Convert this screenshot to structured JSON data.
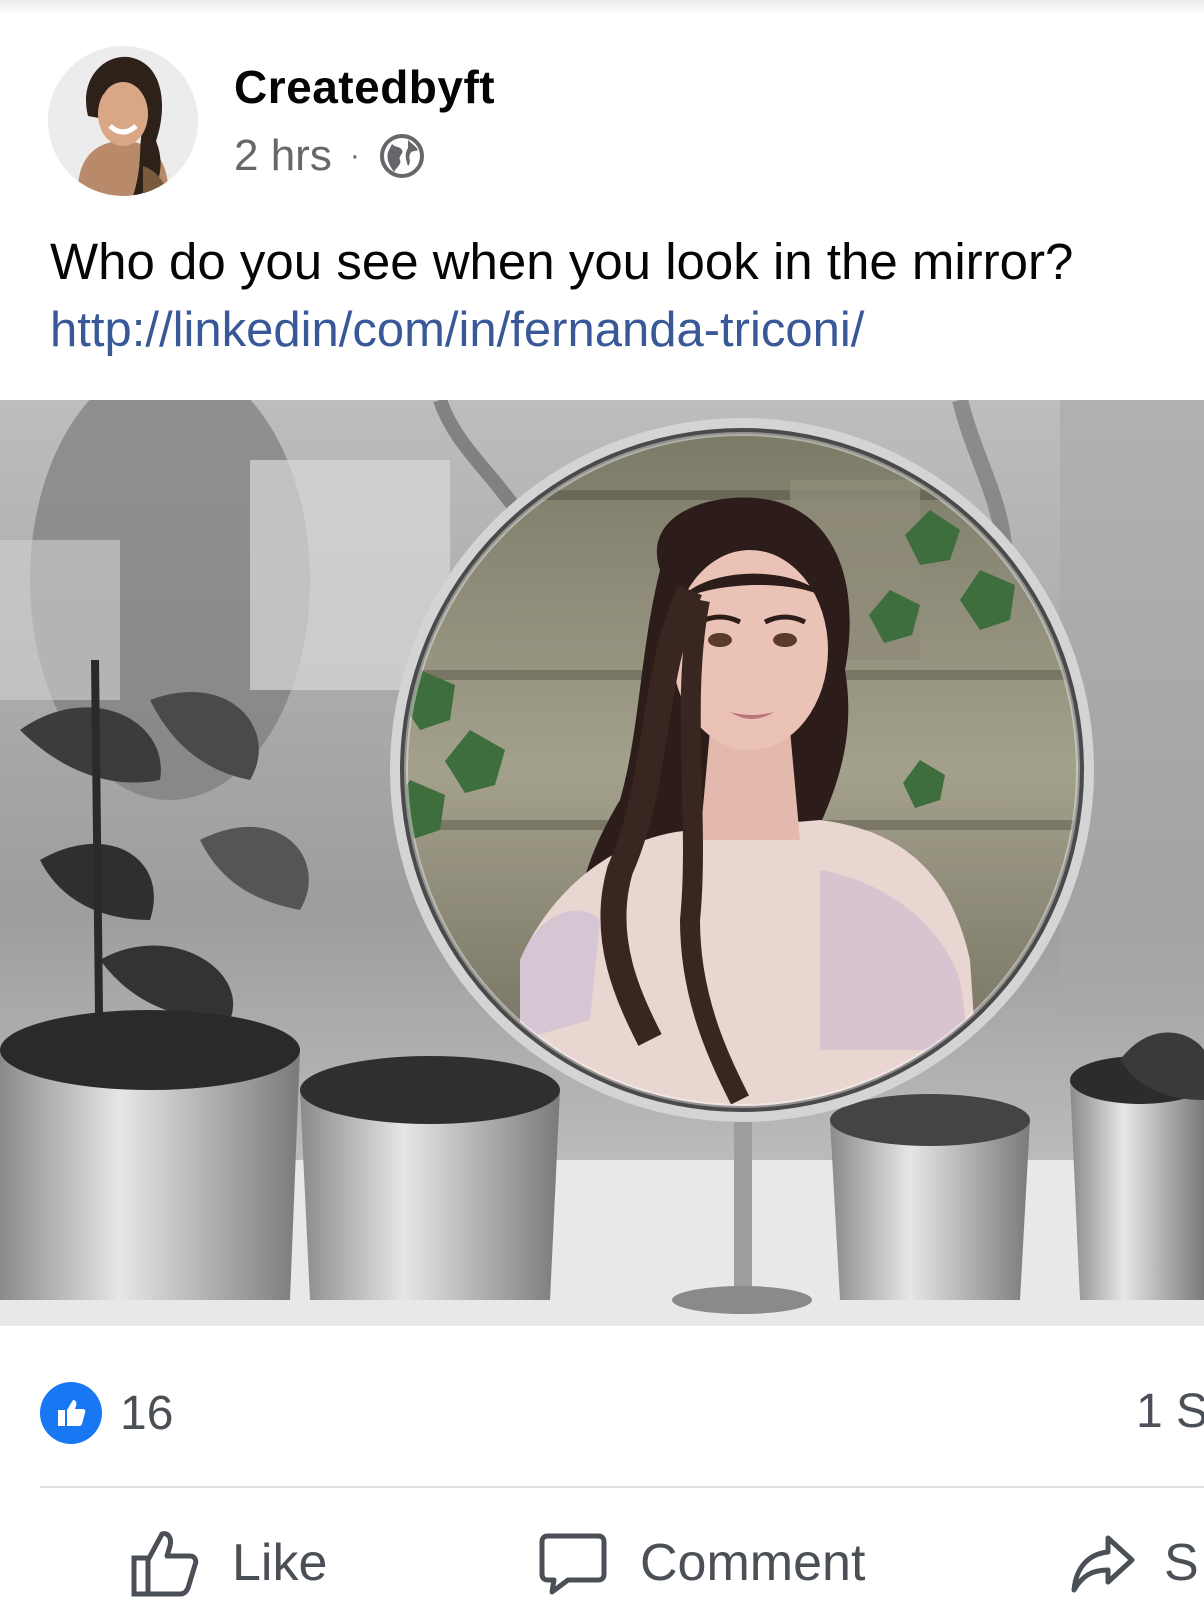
{
  "post": {
    "author": "Createdbyft",
    "time": "2 hrs",
    "separator": "·",
    "privacy_icon": "globe-icon",
    "text": "Who do you see when you look in the mirror?",
    "link": "http://linkedin/com/in/fernanda-triconi/"
  },
  "footer": {
    "reaction_icon": "like-icon",
    "reaction_count": "16",
    "shares_visible": "1 S"
  },
  "actions": {
    "like": "Like",
    "comment": "Comment",
    "share_visible": "S"
  },
  "colors": {
    "link": "#385898",
    "like_blue": "#1877f2",
    "secondary_text": "#65676b"
  }
}
